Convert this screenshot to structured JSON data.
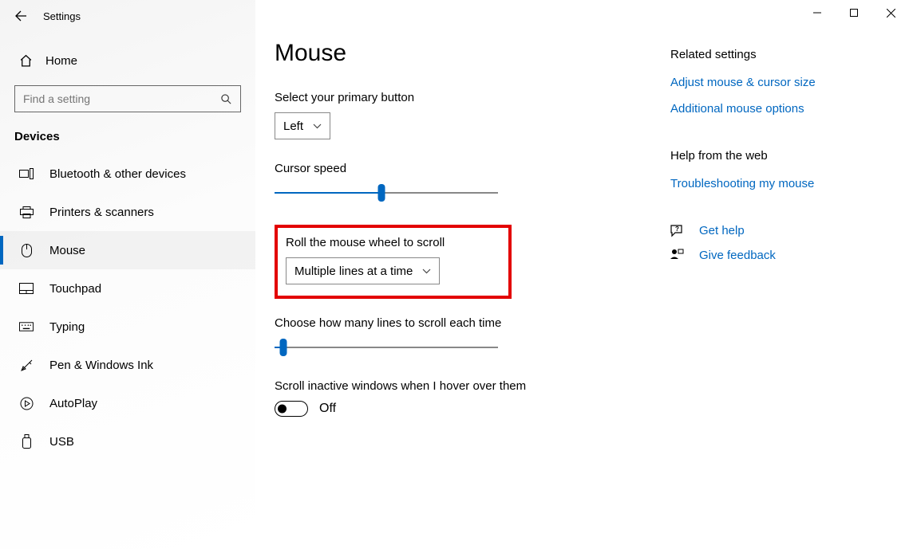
{
  "window": {
    "app_title": "Settings"
  },
  "sidebar": {
    "home_label": "Home",
    "search_placeholder": "Find a setting",
    "category": "Devices",
    "items": [
      {
        "label": "Bluetooth & other devices"
      },
      {
        "label": "Printers & scanners"
      },
      {
        "label": "Mouse"
      },
      {
        "label": "Touchpad"
      },
      {
        "label": "Typing"
      },
      {
        "label": "Pen & Windows Ink"
      },
      {
        "label": "AutoPlay"
      },
      {
        "label": "USB"
      }
    ]
  },
  "main": {
    "heading": "Mouse",
    "primary_button_label": "Select your primary button",
    "primary_button_value": "Left",
    "cursor_speed_label": "Cursor speed",
    "cursor_speed_percent": 48,
    "scroll_label": "Roll the mouse wheel to scroll",
    "scroll_value": "Multiple lines at a time",
    "lines_label": "Choose how many lines to scroll each time",
    "lines_percent": 4,
    "inactive_label": "Scroll inactive windows when I hover over them",
    "inactive_toggle_text": "Off"
  },
  "right": {
    "related_heading": "Related settings",
    "link_adjust": "Adjust mouse & cursor size",
    "link_additional": "Additional mouse options",
    "help_heading": "Help from the web",
    "link_troubleshoot": "Troubleshooting my mouse",
    "get_help": "Get help",
    "give_feedback": "Give feedback"
  }
}
